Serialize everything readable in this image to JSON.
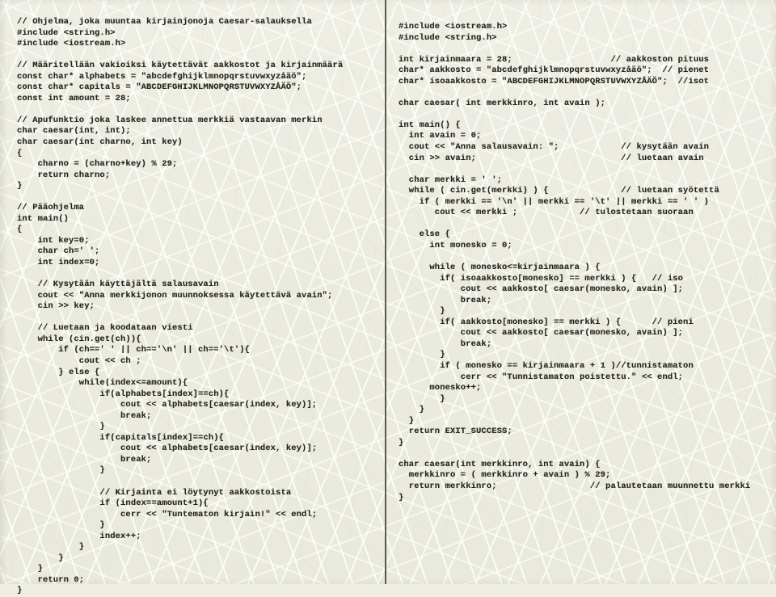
{
  "page": {
    "title": "Caesar-salaus: kaksi C++ koodilistausta",
    "background_color": "#ecece1",
    "text_color": "#23231e",
    "divider_color": "#3b392f",
    "columns": 2
  },
  "left_column": {
    "name": "caesar-listing-version-1",
    "code": "// Ohjelma, joka muuntaa kirjainjonoja Caesar-salauksella\n#include <string.h>\n#include <iostream.h>\n\n// Määritellään vakioiksi käytettävät aakkostot ja kirjainmäärä\nconst char* alphabets = \"abcdefghijklmnopqrstuvwxyzåäö\";\nconst char* capitals = \"ABCDEFGHIJKLMNOPQRSTUVWXYZÅÄÖ\";\nconst int amount = 28;\n\n// Apufunktio joka laskee annettua merkkiä vastaavan merkin\nchar caesar(int, int);\nchar caesar(int charno, int key)\n{\n    charno = (charno+key) % 29;\n    return charno;\n}\n\n// Pääohjelma\nint main()\n{\n    int key=0;\n    char ch=' ';\n    int index=0;\n\n    // Kysytään käyttäjältä salausavain\n    cout << \"Anna merkkijonon muunnoksessa käytettävä avain\";\n    cin >> key;\n\n    // Luetaan ja koodataan viesti\n    while (cin.get(ch)){\n        if (ch==' ' || ch=='\\n' || ch=='\\t'){\n            cout << ch ;\n        } else {\n            while(index<=amount){\n                if(alphabets[index]==ch){\n                    cout << alphabets[caesar(index, key)];\n                    break;\n                }\n                if(capitals[index]==ch){\n                    cout << alphabets[caesar(index, key)];\n                    break;\n                }\n\n                // Kirjainta ei löytynyt aakkostoista\n                if (index==amount+1){\n                    cerr << \"Tuntematon kirjain!\" << endl;\n                }\n                index++;\n            }\n        }\n    }\n    return 0;\n}"
  },
  "right_column": {
    "name": "caesar-listing-version-2",
    "code": "#include <iostream.h>\n#include <string.h>\n\nint kirjainmaara = 28;                   // aakkoston pituus\nchar* aakkosto = \"abcdefghijklmnopqrstuvwxyzåäö\";  // pienet\nchar* isoaakkosto = \"ABCDEFGHIJKLMNOPQRSTUVWXYZÅÄÖ\";  //isot\n\nchar caesar( int merkkinro, int avain );\n\nint main() {\n  int avain = 0;\n  cout << \"Anna salausavain: \";            // kysytään avain\n  cin >> avain;                            // luetaan avain\n\n  char merkki = ' ';\n  while ( cin.get(merkki) ) {              // luetaan syötettä\n    if ( merkki == '\\n' || merkki == '\\t' || merkki == ' ' )\n       cout << merkki ;            // tulostetaan suoraan\n\n    else {\n      int monesko = 0;\n\n      while ( monesko<=kirjainmaara ) {\n        if( isoaakkosto[monesko] == merkki ) {   // iso\n            cout << aakkosto[ caesar(monesko, avain) ];\n            break;\n        }\n        if( aakkosto[monesko] == merkki ) {      // pieni\n            cout << aakkosto[ caesar(monesko, avain) ];\n            break;\n        }\n        if ( monesko == kirjainmaara + 1 )//tunnistamaton\n            cerr << \"Tunnistamaton poistettu.\" << endl;\n      monesko++;\n        }\n    }\n  }\n  return EXIT_SUCCESS;\n}\n\nchar caesar(int merkkinro, int avain) {\n  merkkinro = ( merkkinro + avain ) % 29;\n  return merkkinro;                  // palautetaan muunnettu merkki\n}"
  }
}
